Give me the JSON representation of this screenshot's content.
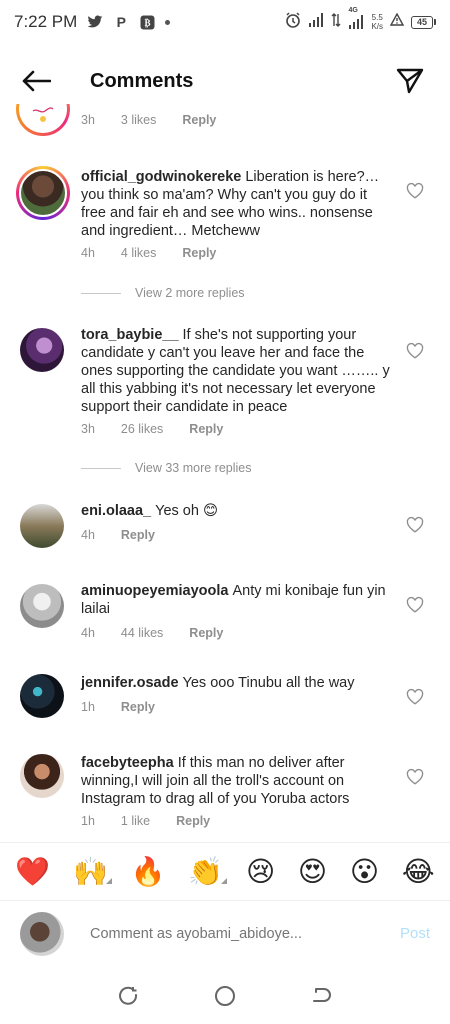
{
  "status_bar": {
    "time": "7:22 PM",
    "network_label": "4G",
    "speed_value": "5.5",
    "speed_unit": "K/s",
    "battery": "45"
  },
  "header": {
    "title": "Comments"
  },
  "comments": [
    {
      "username": "",
      "text": "",
      "time": "3h",
      "likes": "3 likes",
      "reply": "Reply",
      "avatar_icon": "logo-avatar"
    },
    {
      "username": "official_godwinokereke",
      "text": "Liberation is here?… you think so ma'am? Why can't you guy do it free and fair eh and see who wins.. nonsense and ingredient… Metcheww",
      "time": "4h",
      "likes": "4 likes",
      "reply": "Reply",
      "view_replies": "View 2 more replies"
    },
    {
      "username": "tora_baybie__",
      "text": "If she's not supporting your candidate y can't you leave her and face the ones supporting the candidate you want …….. y all this yabbing it's not necessary  let everyone support their candidate in peace",
      "time": "3h",
      "likes": "26 likes",
      "reply": "Reply",
      "view_replies": "View 33 more replies"
    },
    {
      "username": "eni.olaaa_",
      "text": "Yes oh 😊",
      "time": "4h",
      "likes": "",
      "reply": "Reply"
    },
    {
      "username": "aminuopeyemiayoola",
      "text": "Anty mi konibaje fun yin lailai",
      "time": "4h",
      "likes": "44 likes",
      "reply": "Reply"
    },
    {
      "username": "jennifer.osade",
      "text": "Yes ooo Tinubu all the way",
      "time": "1h",
      "likes": "",
      "reply": "Reply"
    },
    {
      "username": "facebyteepha",
      "text": "If this man no deliver after winning,I will join all the troll's account on Instagram to drag all of you Yoruba actors",
      "time": "1h",
      "likes": "1 like",
      "reply": "Reply"
    }
  ],
  "emoji_bar": [
    "❤️",
    "🙌",
    "🔥",
    "👏",
    "😢",
    "😍",
    "😮",
    "😂"
  ],
  "composer": {
    "placeholder": "Comment as ayobami_abidoye...",
    "post_label": "Post"
  },
  "colors": {
    "accent_disabled": "#b2dffc",
    "secondary_text": "#8e8e8e",
    "primary_text": "#262626"
  }
}
